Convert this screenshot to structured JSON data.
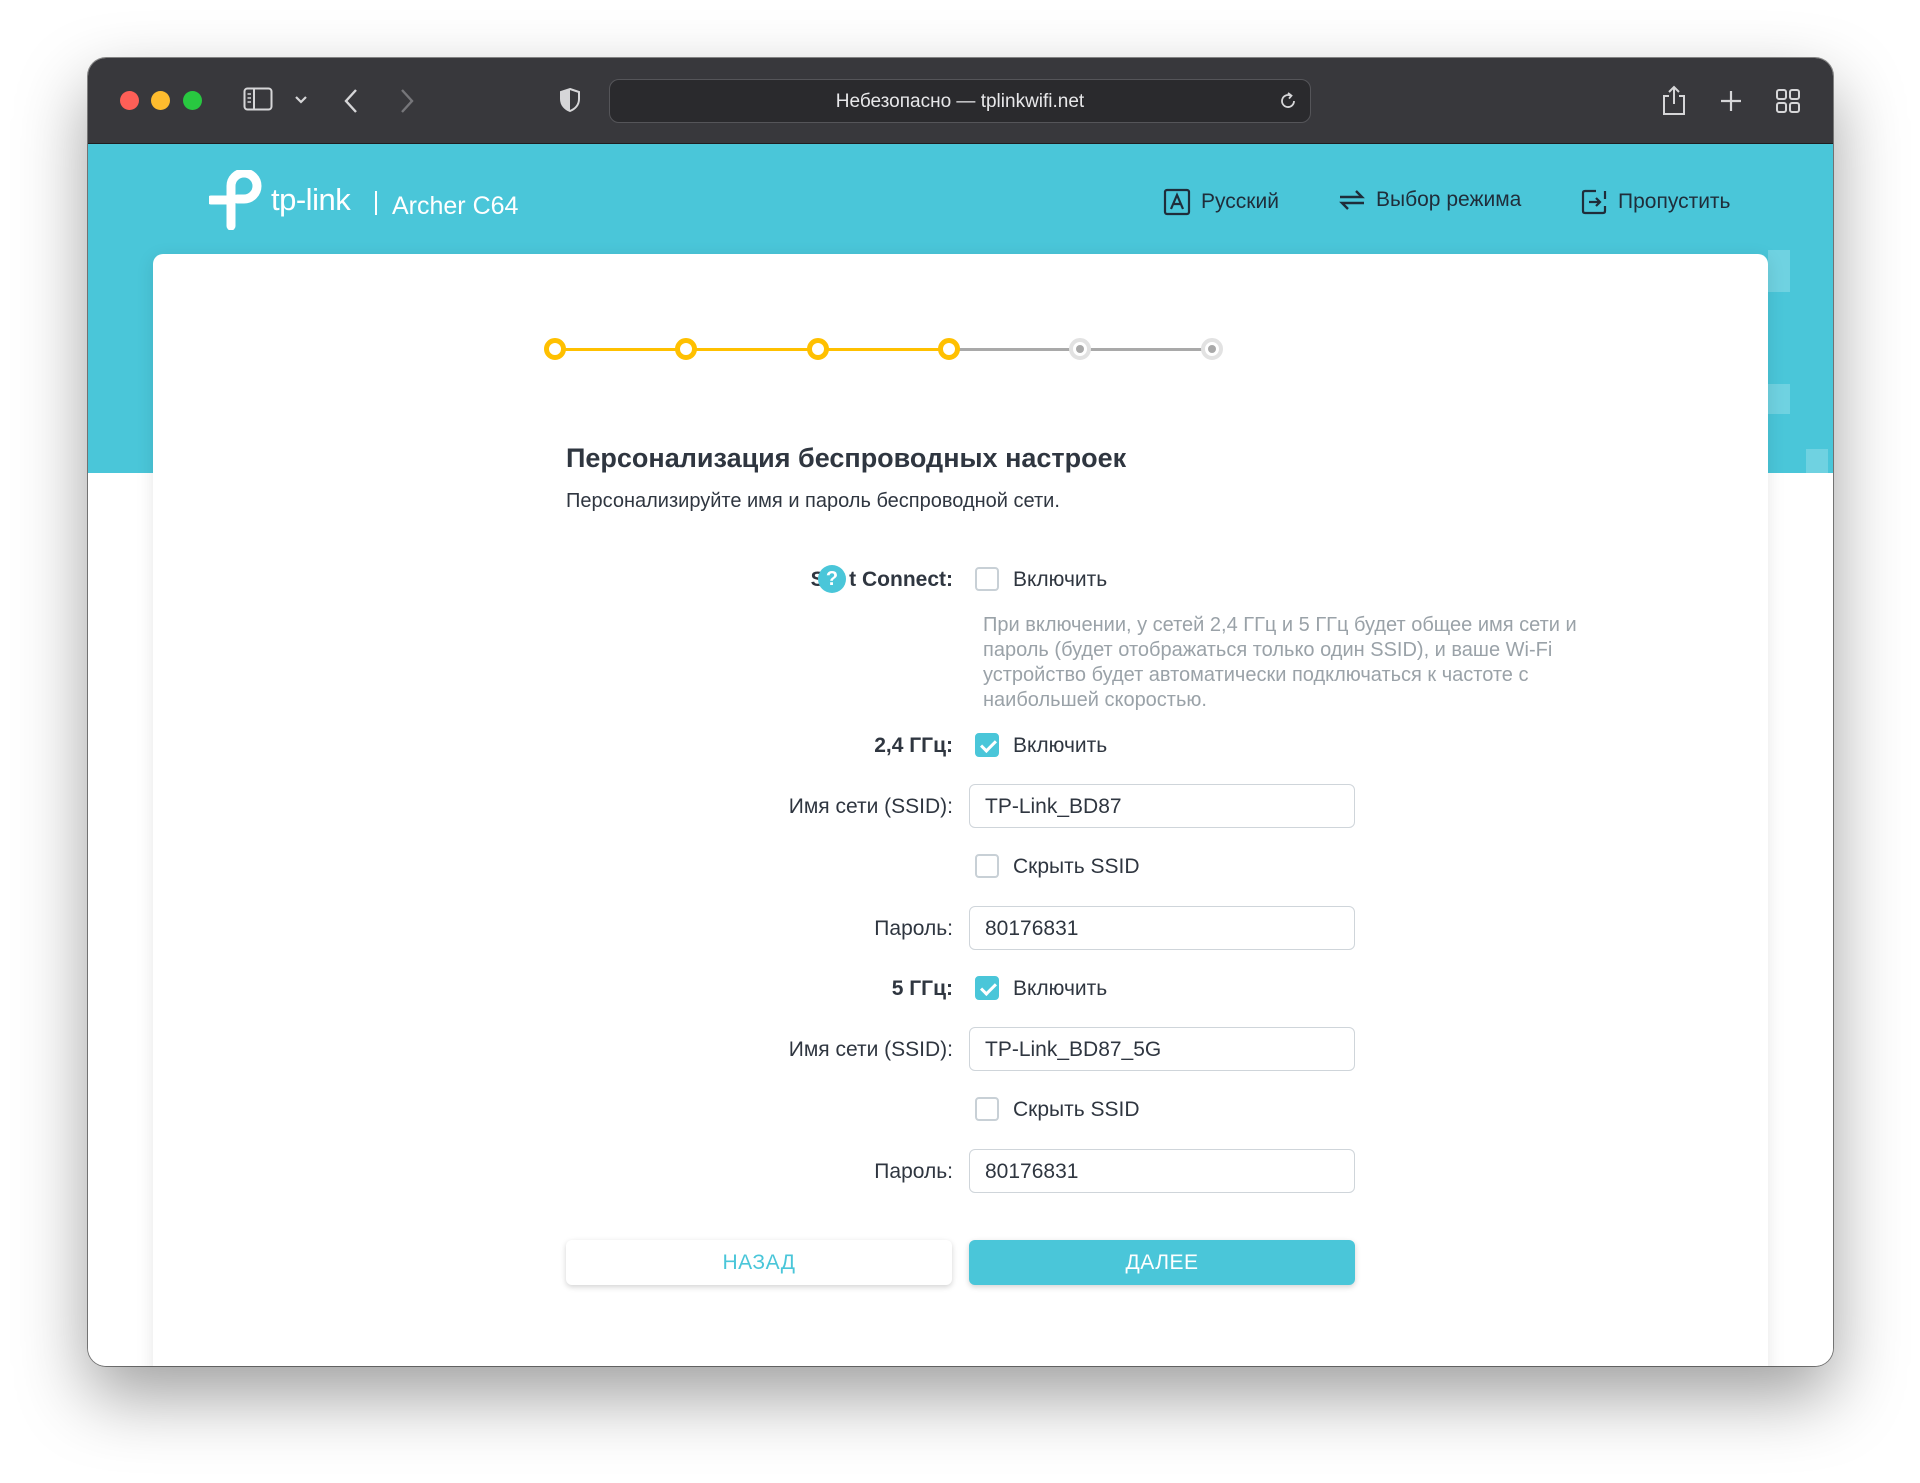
{
  "browser": {
    "address": "Небезопасно — tplinkwifi.net"
  },
  "header": {
    "brand": "tp-link",
    "model": "Archer C64",
    "nav": [
      {
        "label": "Русский",
        "icon": "language-icon"
      },
      {
        "label": "Выбор режима",
        "icon": "mode-switch-icon"
      },
      {
        "label": "Пропустить",
        "icon": "exit-icon"
      }
    ]
  },
  "progress": {
    "total_steps": 6,
    "completed_steps": 4,
    "colors": {
      "done": "#ffc000",
      "todo": "#a9a9a9"
    }
  },
  "form": {
    "title": "Персонализация беспроводных настроек",
    "subtitle": "Персонализируйте имя и пароль беспроводной сети.",
    "smart_connect": {
      "label": "Sm   t Connect:",
      "checkbox_label": "Включить",
      "checked": false,
      "help_glyph": "?",
      "note": "При включении, у сетей 2,4 ГГц и 5 ГГц будет общее имя сети и пароль (будет отображаться только один SSID), и ваше Wi-Fi устройство будет автоматически подключаться к частоте с наибольшей скоростью."
    },
    "band_24": {
      "label": "2,4 ГГц:",
      "enable_label": "Включить",
      "enabled": true,
      "ssid_label": "Имя сети (SSID):",
      "ssid": "TP-Link_BD87",
      "hide_label": "Скрыть SSID",
      "hidden": false,
      "password_label": "Пароль:",
      "password": "80176831"
    },
    "band_5": {
      "label": "5 ГГц:",
      "enable_label": "Включить",
      "enabled": true,
      "ssid_label": "Имя сети (SSID):",
      "ssid": "TP-Link_BD87_5G",
      "hide_label": "Скрыть SSID",
      "hidden": false,
      "password_label": "Пароль:",
      "password": "80176831"
    },
    "buttons": {
      "back": "НАЗАД",
      "next": "ДАЛЕЕ"
    }
  },
  "colors": {
    "accent": "#4ac6d9",
    "progress": "#ffc000",
    "text": "#2f3640"
  }
}
